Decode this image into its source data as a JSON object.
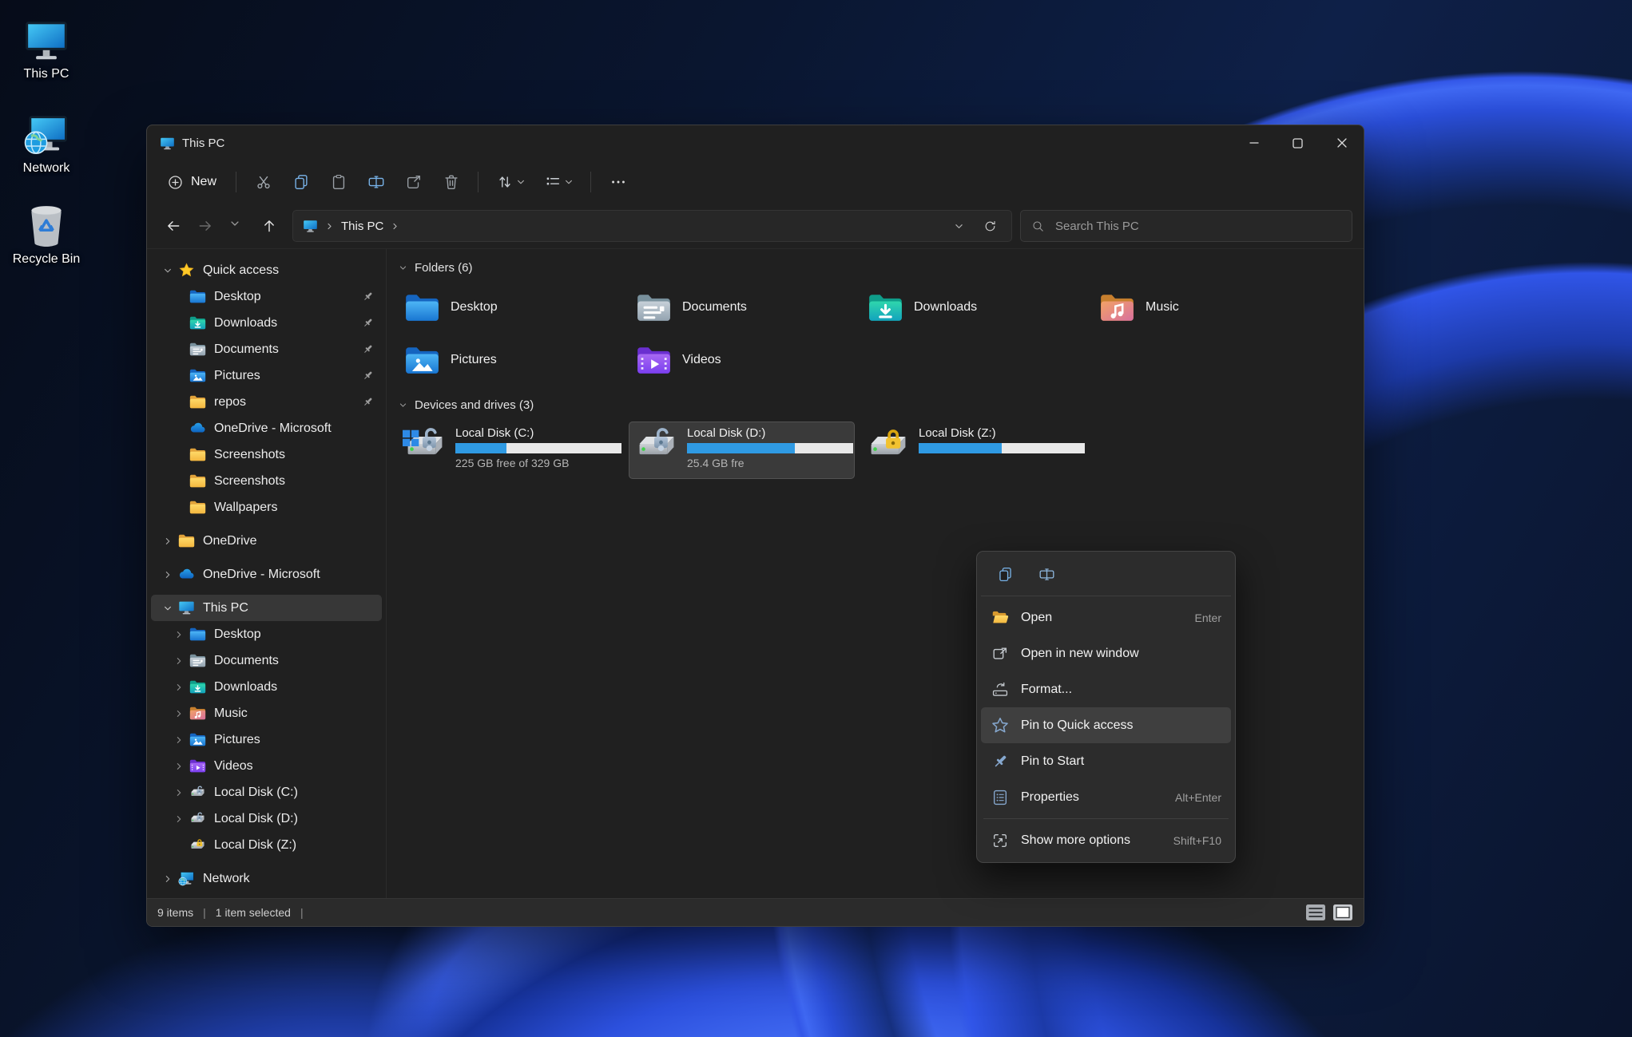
{
  "desktop": {
    "icons": [
      {
        "label": "This PC",
        "icon": "this-pc-icon"
      },
      {
        "label": "Network",
        "icon": "network-icon"
      },
      {
        "label": "Recycle Bin",
        "icon": "recycle-bin-icon"
      }
    ]
  },
  "window": {
    "title": "This PC",
    "toolbar": {
      "new_label": "New",
      "icons": [
        "plus-icon",
        "cut-icon",
        "copy-icon",
        "paste-icon",
        "rename-icon",
        "share-icon",
        "delete-icon",
        "sort-icon",
        "view-icon",
        "more-icon"
      ]
    },
    "nav": {
      "breadcrumb_root": "This PC",
      "search_placeholder": "Search This PC",
      "icons": [
        "back-icon",
        "forward-icon",
        "recent-locations-icon",
        "up-icon",
        "address-dropdown-icon",
        "refresh-icon",
        "search-icon"
      ]
    },
    "sidebar": {
      "quick_access_label": "Quick access",
      "quick_access": [
        {
          "label": "Desktop",
          "icon": "folder-desktop-icon",
          "pinned": true
        },
        {
          "label": "Downloads",
          "icon": "folder-downloads-icon",
          "pinned": true
        },
        {
          "label": "Documents",
          "icon": "folder-documents-icon",
          "pinned": true
        },
        {
          "label": "Pictures",
          "icon": "folder-pictures-icon",
          "pinned": true
        },
        {
          "label": "repos",
          "icon": "folder-icon",
          "pinned": true
        },
        {
          "label": "OneDrive - Microsoft",
          "icon": "onedrive-icon",
          "pinned": false
        },
        {
          "label": "Screenshots",
          "icon": "folder-icon",
          "pinned": false
        },
        {
          "label": "Screenshots",
          "icon": "folder-icon",
          "pinned": false
        },
        {
          "label": "Wallpapers",
          "icon": "folder-icon",
          "pinned": false
        }
      ],
      "roots": {
        "onedrive": "OneDrive",
        "onedrive_ms": "OneDrive - Microsoft",
        "this_pc": "This PC",
        "network": "Network"
      },
      "this_pc_children": [
        {
          "label": "Desktop",
          "icon": "folder-desktop-icon"
        },
        {
          "label": "Documents",
          "icon": "folder-documents-icon"
        },
        {
          "label": "Downloads",
          "icon": "folder-downloads-icon"
        },
        {
          "label": "Music",
          "icon": "folder-music-icon"
        },
        {
          "label": "Pictures",
          "icon": "folder-pictures-icon"
        },
        {
          "label": "Videos",
          "icon": "folder-videos-icon"
        },
        {
          "label": "Local Disk (C:)",
          "icon": "drive-unlocked-icon"
        },
        {
          "label": "Local Disk (D:)",
          "icon": "drive-unlocked-icon"
        },
        {
          "label": "Local Disk (Z:)",
          "icon": "drive-locked-icon"
        }
      ]
    },
    "content": {
      "folders_title": "Folders (6)",
      "folders": [
        {
          "label": "Desktop",
          "icon": "folder-desktop-icon"
        },
        {
          "label": "Documents",
          "icon": "folder-documents-icon"
        },
        {
          "label": "Downloads",
          "icon": "folder-downloads-icon"
        },
        {
          "label": "Music",
          "icon": "folder-music-icon"
        },
        {
          "label": "Pictures",
          "icon": "folder-pictures-icon"
        },
        {
          "label": "Videos",
          "icon": "folder-videos-icon"
        }
      ],
      "drives_title": "Devices and drives (3)",
      "drives": [
        {
          "label": "Local Disk (C:)",
          "free": "225 GB free of 329 GB",
          "used_pct": 31,
          "icon": "drive-c-icon",
          "selected": false
        },
        {
          "label": "Local Disk (D:)",
          "free": "25.4 GB fre",
          "used_pct": 65,
          "icon": "drive-unlocked-icon",
          "selected": true
        },
        {
          "label": "Local Disk (Z:)",
          "free": "",
          "used_pct": 50,
          "icon": "drive-locked-icon",
          "selected": false
        }
      ]
    },
    "context_menu": {
      "quick_icons": [
        "copy-icon",
        "rename-icon"
      ],
      "items": [
        {
          "label": "Open",
          "shortcut": "Enter",
          "icon": "open-folder-icon"
        },
        {
          "label": "Open in new window",
          "shortcut": "",
          "icon": "open-new-window-icon"
        },
        {
          "label": "Format...",
          "shortcut": "",
          "icon": "format-drive-icon"
        },
        {
          "label": "Pin to Quick access",
          "shortcut": "",
          "icon": "star-icon"
        },
        {
          "label": "Pin to Start",
          "shortcut": "",
          "icon": "pin-icon"
        },
        {
          "label": "Properties",
          "shortcut": "Alt+Enter",
          "icon": "properties-icon"
        },
        {
          "label": "Show more options",
          "shortcut": "Shift+F10",
          "icon": "show-more-icon"
        }
      ]
    },
    "statusbar": {
      "count": "9 items",
      "selected": "1 item selected"
    }
  },
  "colors": {
    "accent": "#2e8ae6",
    "bar_fill": "#2f9ae3",
    "selection_bg": "#373737",
    "menu_bg": "#2c2c2c",
    "window_bg": "#202020"
  }
}
